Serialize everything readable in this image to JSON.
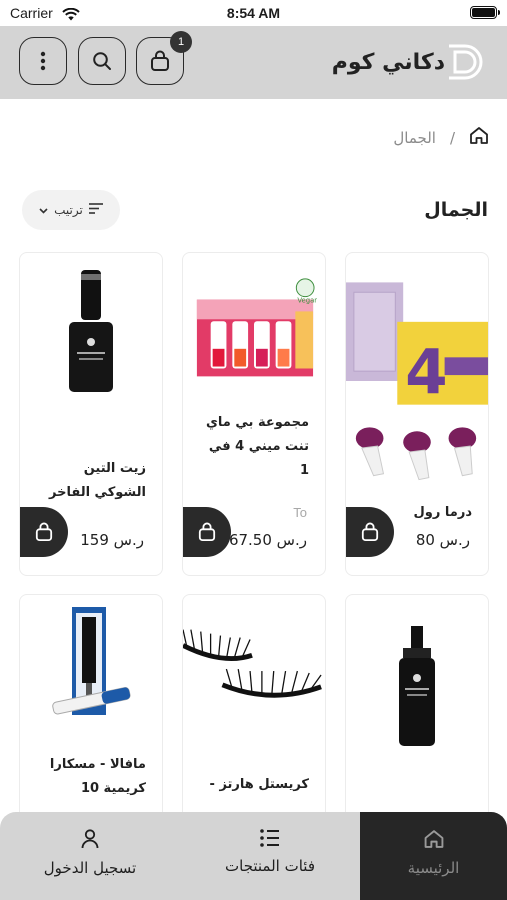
{
  "status": {
    "carrier": "Carrier",
    "time": "8:54 AM"
  },
  "header": {
    "brand_name": "دكاني كوم",
    "cart_count": "1"
  },
  "breadcrumb": {
    "current": "الجمال",
    "separator": "/"
  },
  "page": {
    "title": "الجمال",
    "sort_label": "ترتيب"
  },
  "products": [
    {
      "name": "درما رول",
      "old_price": "",
      "price": "80 ر.س"
    },
    {
      "name": "مجموعة بي ماي تنت ميني 4 في 1",
      "old_price": "To",
      "price": "67.50 ر.س"
    },
    {
      "name": "زيت التين الشوكي الفاخر",
      "old_price": "",
      "price": "159 ر.س"
    },
    {
      "name": "",
      "old_price": "",
      "price": ""
    },
    {
      "name": "كريستل هارتز -",
      "old_price": "",
      "price": ""
    },
    {
      "name": "مافالا - مسكارا كريمية 10",
      "old_price": "",
      "price": ""
    }
  ],
  "vegan_badge": "Vegan",
  "bottom_nav": {
    "home": "الرئيسية",
    "categories": "فئات المنتجات",
    "login": "تسجيل الدخول"
  },
  "colors": {
    "header_bg": "#d4d4d4",
    "dark": "#262626",
    "muted": "#8b8b8b"
  }
}
